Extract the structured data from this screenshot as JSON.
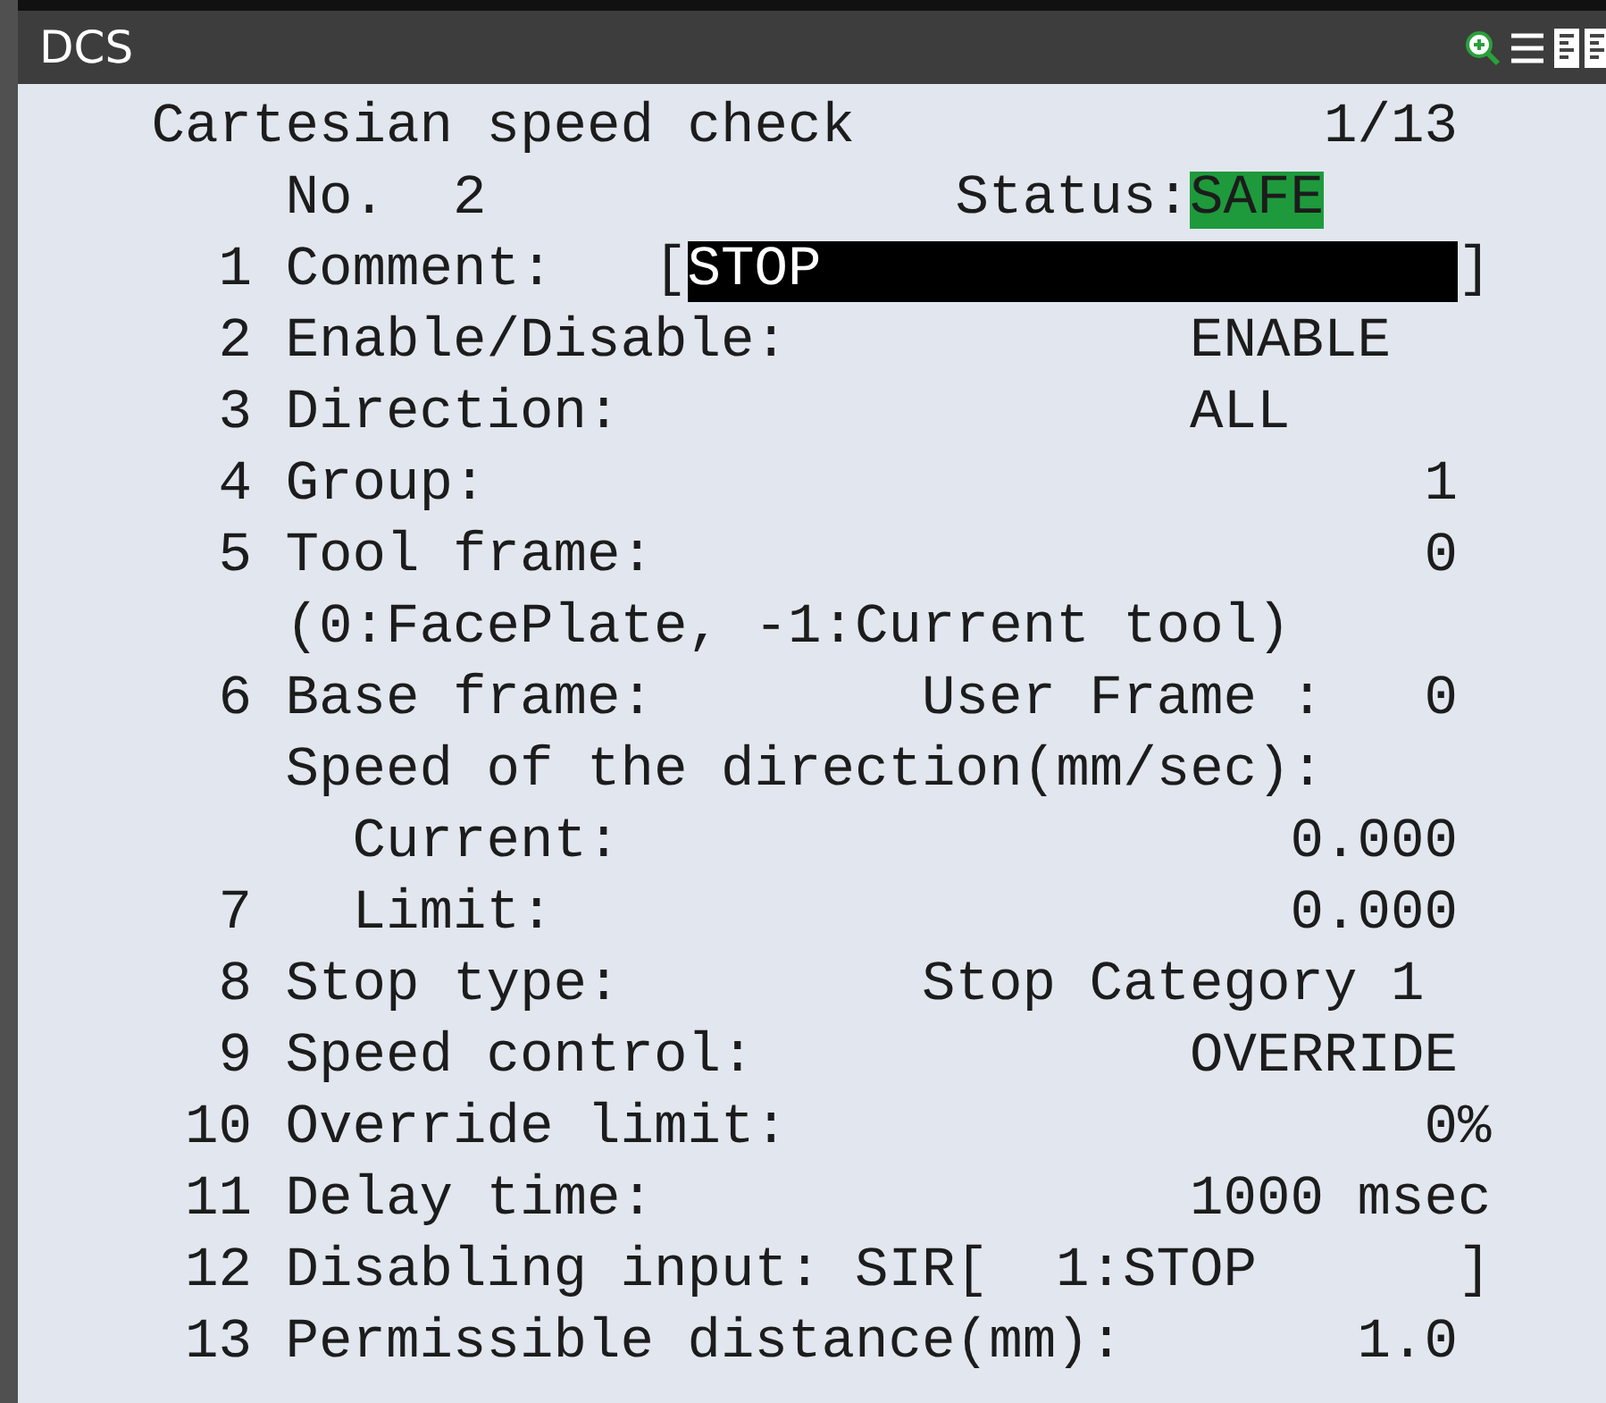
{
  "window": {
    "title": "DCS"
  },
  "screen": {
    "title": "Cartesian speed check",
    "page": "1/13",
    "number_label": "No.",
    "number": "2",
    "status_label": "Status:",
    "status": "SAFE"
  },
  "items": [
    {
      "kind": "field",
      "num": "1",
      "label": "Comment:",
      "open": "[",
      "value": "STOP",
      "close": "]",
      "selected": true
    },
    {
      "kind": "choice",
      "num": "2",
      "label": "Enable/Disable:",
      "value": "ENABLE"
    },
    {
      "kind": "choice",
      "num": "3",
      "label": "Direction:",
      "value": "ALL"
    },
    {
      "kind": "number",
      "num": "4",
      "label": "Group:",
      "value": "1"
    },
    {
      "kind": "number",
      "num": "5",
      "label": "Tool frame:",
      "value": "0"
    },
    {
      "kind": "note",
      "label": "(0:FacePlate, -1:Current tool)"
    },
    {
      "kind": "pair",
      "num": "6",
      "label": "Base frame:",
      "sublabel": "User Frame :",
      "value": "0"
    },
    {
      "kind": "note",
      "label": "Speed of the direction(mm/sec):"
    },
    {
      "kind": "sub",
      "label": "Current:",
      "value": "0.000"
    },
    {
      "kind": "sub",
      "num": "7",
      "label": "Limit:",
      "value": "0.000"
    },
    {
      "kind": "text",
      "num": "8",
      "label": "Stop type:",
      "value": "Stop Category 1"
    },
    {
      "kind": "choice",
      "num": "9",
      "label": "Speed control:",
      "value": "OVERRIDE"
    },
    {
      "kind": "unit",
      "num": "10",
      "label": "Override limit:",
      "value": "0%"
    },
    {
      "kind": "unit",
      "num": "11",
      "label": "Delay time:",
      "value": "1000 msec"
    },
    {
      "kind": "input",
      "num": "12",
      "label": "Disabling input:",
      "value": "SIR[  1:STOP      ]"
    },
    {
      "kind": "number",
      "num": "13",
      "label": "Permissible distance(mm):",
      "value": "1.0"
    }
  ]
}
